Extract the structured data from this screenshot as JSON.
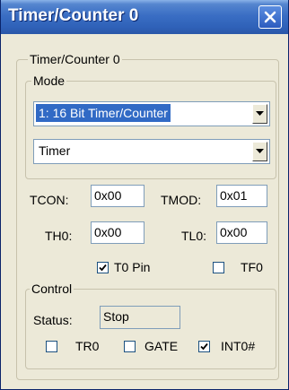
{
  "window": {
    "title": "Timer/Counter 0"
  },
  "group_main": {
    "legend": "Timer/Counter 0"
  },
  "mode": {
    "legend": "Mode",
    "mode_select": "1: 16 Bit Timer/Counter",
    "function_select": "Timer"
  },
  "registers": {
    "tcon": {
      "label": "TCON:",
      "value": "0x00"
    },
    "tmod": {
      "label": "TMOD:",
      "value": "0x01"
    },
    "th0": {
      "label": "TH0:",
      "value": "0x00"
    },
    "tl0": {
      "label": "TL0:",
      "value": "0x00"
    }
  },
  "pins": {
    "t0_pin": {
      "label": "T0 Pin",
      "checked": true
    },
    "tf0": {
      "label": "TF0",
      "checked": false
    }
  },
  "control": {
    "legend": "Control",
    "status_label": "Status:",
    "status_value": "Stop",
    "tr0": {
      "label": "TR0",
      "checked": false
    },
    "gate": {
      "label": "GATE",
      "checked": false
    },
    "int0": {
      "label": "INT0#",
      "checked": true
    }
  },
  "icons": {
    "close": "close-icon",
    "dropdown": "chevron-down-icon",
    "check": "checkmark-icon"
  },
  "colors": {
    "titlebar": "#2f61b8",
    "dialog_bg": "#ece9d8",
    "selection": "#316ac5"
  }
}
